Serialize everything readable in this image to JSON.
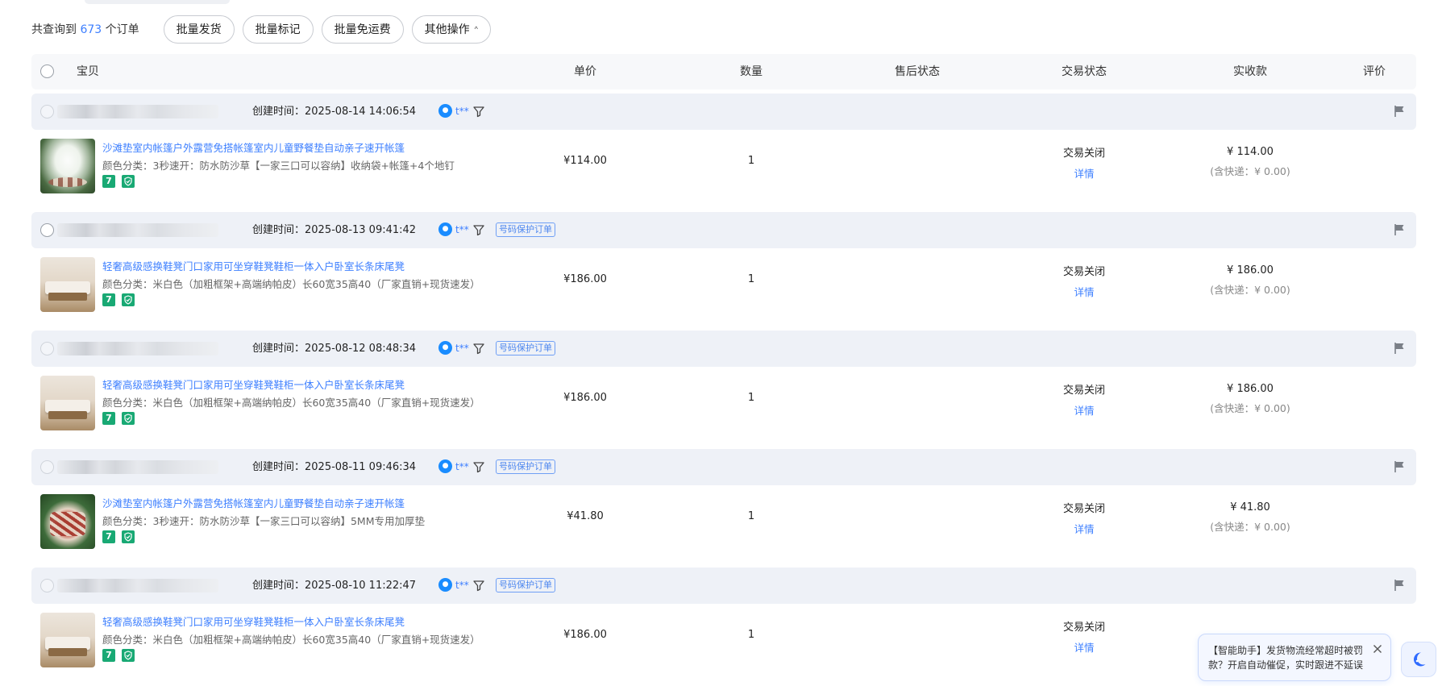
{
  "toolbar": {
    "count_prefix": "共查询到",
    "count_value": "673",
    "count_suffix": "个订单",
    "batch_ship": "批量发货",
    "batch_mark": "批量标记",
    "batch_free_shipping": "批量免运费",
    "other_ops": "其他操作",
    "other_ops_chevron": "^"
  },
  "table_header": {
    "item": "宝贝",
    "unit_price": "单价",
    "quantity": "数量",
    "after_sale": "售后状态",
    "trade_status": "交易状态",
    "paid": "实收款",
    "review": "评价"
  },
  "orders": [
    {
      "created": "创建时间：2025-08-14 14:06:54",
      "buyer": "t**",
      "protect_tag": "",
      "title": "沙滩垫室内帐篷户外露营免搭帐篷室内儿童野餐垫自动亲子速开帐篷",
      "sku": "颜色分类：3秒速开：防水防沙草【一家三口可以容纳】收纳袋+帐篷+4个地钉",
      "price": "¥114.00",
      "qty": "1",
      "status": "交易关闭",
      "detail": "详情",
      "paid": "¥ 114.00",
      "shipping": "(含快递：¥ 0.00)"
    },
    {
      "created": "创建时间：2025-08-13 09:41:42",
      "buyer": "t**",
      "protect_tag": "号码保护订单",
      "title": "轻奢高级感换鞋凳门口家用可坐穿鞋凳鞋柜一体入户卧室长条床尾凳",
      "sku": "颜色分类：米白色（加粗框架+高端纳帕皮）长60宽35高40（厂家直销+现货速发）",
      "price": "¥186.00",
      "qty": "1",
      "status": "交易关闭",
      "detail": "详情",
      "paid": "¥ 186.00",
      "shipping": "(含快递：¥ 0.00)"
    },
    {
      "created": "创建时间：2025-08-12 08:48:34",
      "buyer": "t**",
      "protect_tag": "号码保护订单",
      "title": "轻奢高级感换鞋凳门口家用可坐穿鞋凳鞋柜一体入户卧室长条床尾凳",
      "sku": "颜色分类：米白色（加粗框架+高端纳帕皮）长60宽35高40（厂家直销+现货速发）",
      "price": "¥186.00",
      "qty": "1",
      "status": "交易关闭",
      "detail": "详情",
      "paid": "¥ 186.00",
      "shipping": "(含快递：¥ 0.00)"
    },
    {
      "created": "创建时间：2025-08-11 09:46:34",
      "buyer": "t**",
      "protect_tag": "号码保护订单",
      "title": "沙滩垫室内帐篷户外露营免搭帐篷室内儿童野餐垫自动亲子速开帐篷",
      "sku": "颜色分类：3秒速开：防水防沙草【一家三口可以容纳】5MM专用加厚垫",
      "price": "¥41.80",
      "qty": "1",
      "status": "交易关闭",
      "detail": "详情",
      "paid": "¥ 41.80",
      "shipping": "(含快递：¥ 0.00)"
    },
    {
      "created": "创建时间：2025-08-10 11:22:47",
      "buyer": "t**",
      "protect_tag": "号码保护订单",
      "title": "轻奢高级感换鞋凳门口家用可坐穿鞋凳鞋柜一体入户卧室长条床尾凳",
      "sku": "颜色分类：米白色（加粗框架+高端纳帕皮）长60宽35高40（厂家直销+现货速发）",
      "price": "¥186.00",
      "qty": "1",
      "status": "交易关闭",
      "detail": "详情",
      "paid": "",
      "shipping": ""
    }
  ],
  "badges": {
    "b1": "7"
  },
  "assistant": {
    "tip": "【智能助手】发货物流经常超时被罚款？开启自动催促，实时跟进不延误"
  },
  "icons": {
    "buyer_icon": "wangwang-chat-icon",
    "filter": "filter-funnel-icon",
    "flag": "flag-icon",
    "close": "close-icon",
    "assistant": "moon-assistant-icon"
  },
  "colors": {
    "link_blue": "#3d7fff",
    "badge_green": "#19a974",
    "row_bg": "#eef1f7"
  }
}
